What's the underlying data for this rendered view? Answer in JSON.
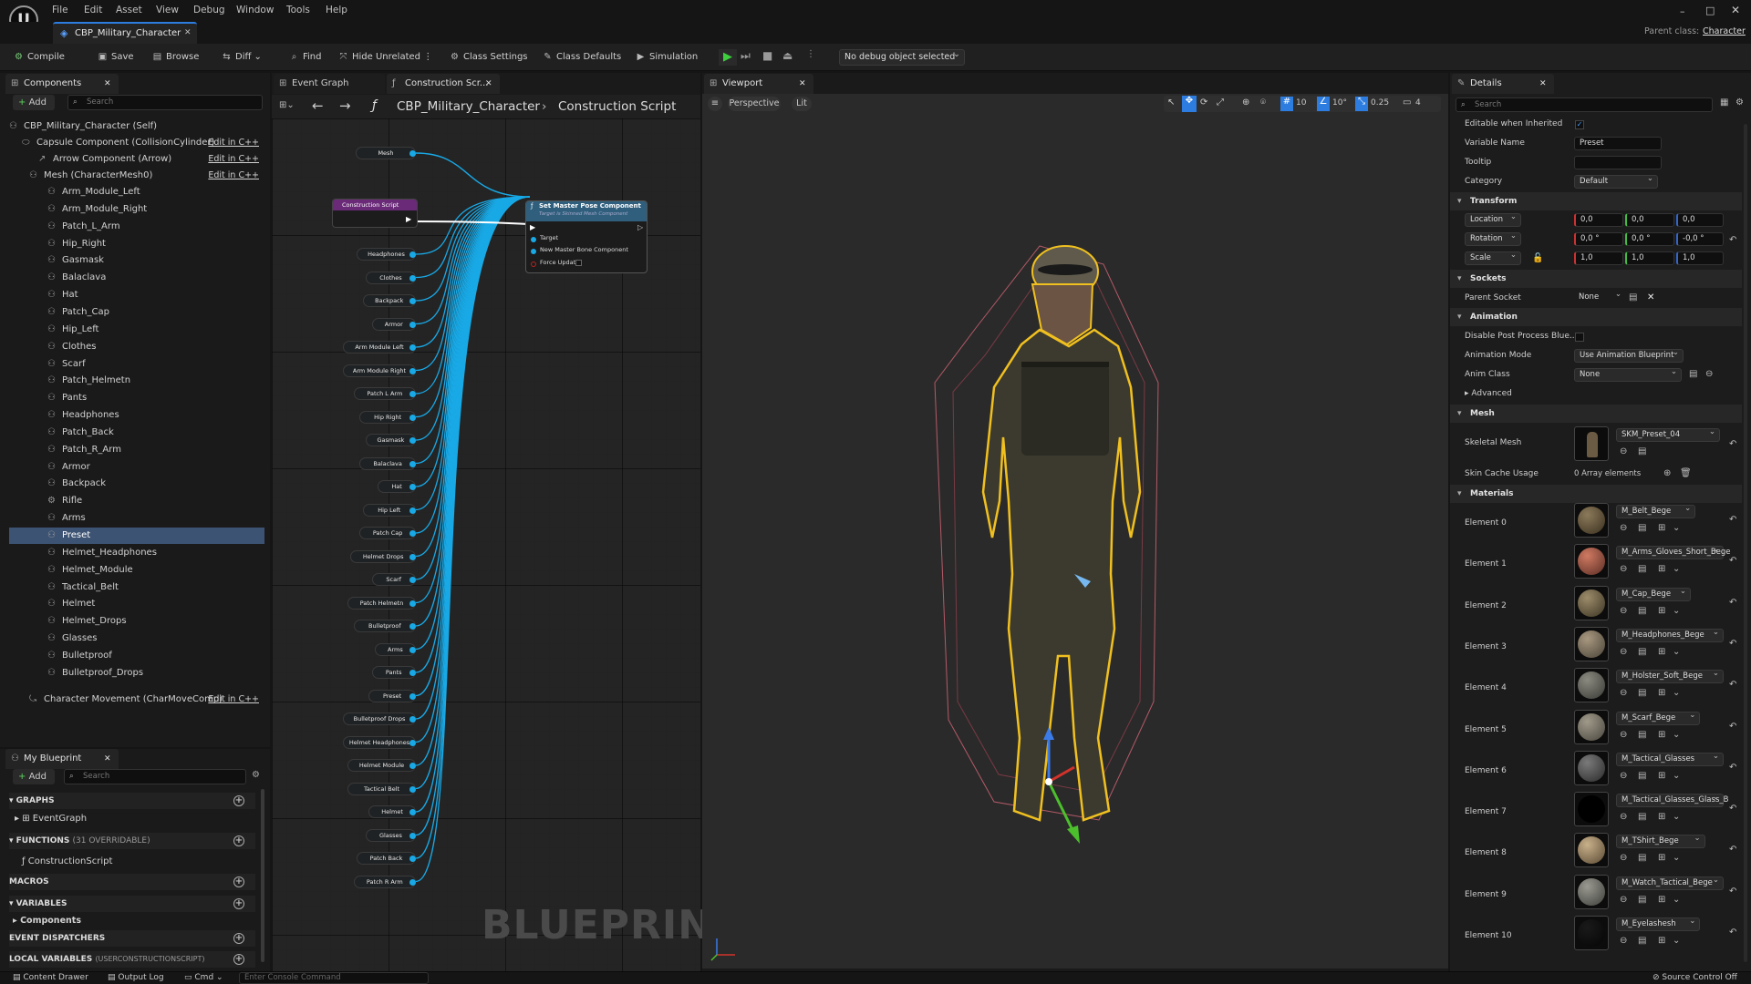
{
  "menu": [
    "File",
    "Edit",
    "Asset",
    "View",
    "Debug",
    "Window",
    "Tools",
    "Help"
  ],
  "document_tab": "CBP_Military_Character",
  "parent_class_label": "Parent class:",
  "parent_class_value": "Character",
  "toolbar": {
    "compile": "Compile",
    "save": "Save",
    "browse": "Browse",
    "diff": "Diff",
    "find": "Find",
    "hide_unrelated": "Hide Unrelated",
    "class_settings": "Class Settings",
    "class_defaults": "Class Defaults",
    "simulation": "Simulation",
    "debug_select": "No debug object selected"
  },
  "components": {
    "tab": "Components",
    "add": "Add",
    "search_placeholder": "Search",
    "root": "CBP_Military_Character (Self)",
    "capsule": "Capsule Component (CollisionCylinder)",
    "arrow": "Arrow Component (Arrow)",
    "mesh": "Mesh (CharacterMesh0)",
    "edit_cpp": "Edit in C++",
    "children": [
      "Arm_Module_Left",
      "Arm_Module_Right",
      "Patch_L_Arm",
      "Hip_Right",
      "Gasmask",
      "Balaclava",
      "Hat",
      "Patch_Cap",
      "Hip_Left",
      "Clothes",
      "Scarf",
      "Patch_Helmetn",
      "Pants",
      "Headphones",
      "Patch_Back",
      "Patch_R_Arm",
      "Armor",
      "Backpack",
      "Rifle",
      "Arms",
      "Preset",
      "Helmet_Headphones",
      "Helmet_Module",
      "Tactical_Belt",
      "Helmet",
      "Helmet_Drops",
      "Glasses",
      "Bulletproof",
      "Bulletproof_Drops"
    ],
    "selected": "Preset",
    "movement": "Character Movement (CharMoveComp)"
  },
  "my_blueprint": {
    "tab": "My Blueprint",
    "add": "Add",
    "search_placeholder": "Search",
    "graphs": "GRAPHS",
    "event_graph": "EventGraph",
    "functions": "FUNCTIONS",
    "functions_note": "(31 OVERRIDABLE)",
    "construction_script": "ConstructionScript",
    "macros": "MACROS",
    "variables": "VARIABLES",
    "components_cat": "Components",
    "event_dispatchers": "EVENT DISPATCHERS",
    "local_variables": "LOCAL VARIABLES",
    "local_variables_note": "(USERCONSTRUCTIONSCRIPT)"
  },
  "graph": {
    "tab_event": "Event Graph",
    "tab_construction": "Construction Scr...",
    "breadcrumb_root": "CBP_Military_Character",
    "breadcrumb_leaf": "Construction Script",
    "watermark": "BLUEPRINT",
    "construction_node": "Construction Script",
    "set_node_title": "Set Master Pose Component",
    "set_node_subtitle": "Target is Skinned Mesh Component",
    "set_node_target": "Target",
    "set_node_master": "New Master Bone Component",
    "set_node_force": "Force Update",
    "mesh_pin": "Mesh",
    "pins": [
      "Headphones",
      "Clothes",
      "Backpack",
      "Armor",
      "Arm Module Left",
      "Arm Module Right",
      "Patch L Arm",
      "Hip Right",
      "Gasmask",
      "Balaclava",
      "Hat",
      "Hip Left",
      "Patch Cap",
      "Helmet Drops",
      "Scarf",
      "Patch Helmetn",
      "Bulletproof",
      "Arms",
      "Pants",
      "Preset",
      "Bulletproof Drops",
      "Helmet Headphones",
      "Helmet Module",
      "Tactical Belt",
      "Helmet",
      "Glasses",
      "Patch Back",
      "Patch R Arm"
    ]
  },
  "viewport": {
    "tab": "Viewport",
    "perspective": "Perspective",
    "lit": "Lit",
    "grid": "10",
    "angle": "10°",
    "scale": "0.25",
    "cam": "4"
  },
  "details": {
    "tab": "Details",
    "search_placeholder": "Search",
    "editable_label": "Editable when Inherited",
    "variable_name_label": "Variable Name",
    "variable_name": "Preset",
    "tooltip_label": "Tooltip",
    "category_label": "Category",
    "category": "Default",
    "transform": "Transform",
    "location": "Location",
    "rotation": "Rotation",
    "scale": "Scale",
    "loc": [
      "0,0",
      "0,0",
      "0,0"
    ],
    "rot": [
      "0,0 °",
      "0,0 °",
      "-0,0 °"
    ],
    "scl": [
      "1,0",
      "1,0",
      "1,0"
    ],
    "sockets": "Sockets",
    "parent_socket_label": "Parent Socket",
    "parent_socket": "None",
    "animation": "Animation",
    "disable_pp": "Disable Post Process Blue...",
    "anim_mode_label": "Animation Mode",
    "anim_mode": "Use Animation Blueprint",
    "anim_class_label": "Anim Class",
    "anim_class": "None",
    "advanced": "Advanced",
    "mesh": "Mesh",
    "skeletal_mesh_label": "Skeletal Mesh",
    "skeletal_mesh": "SKM_Preset_04",
    "skin_cache_label": "Skin Cache Usage",
    "skin_cache": "0 Array elements",
    "materials": "Materials",
    "elements": [
      {
        "label": "Element 0",
        "value": "M_Belt_Bege"
      },
      {
        "label": "Element 1",
        "value": "M_Arms_Gloves_Short_Bege"
      },
      {
        "label": "Element 2",
        "value": "M_Cap_Bege"
      },
      {
        "label": "Element 3",
        "value": "M_Headphones_Bege"
      },
      {
        "label": "Element 4",
        "value": "M_Holster_Soft_Bege"
      },
      {
        "label": "Element 5",
        "value": "M_Scarf_Bege"
      },
      {
        "label": "Element 6",
        "value": "M_Tactical_Glasses"
      },
      {
        "label": "Element 7",
        "value": "M_Tactical_Glasses_Glass_B"
      },
      {
        "label": "Element 8",
        "value": "M_TShirt_Bege"
      },
      {
        "label": "Element 9",
        "value": "M_Watch_Tactical_Bege"
      },
      {
        "label": "Element 10",
        "value": "M_Eyelashesh"
      }
    ]
  },
  "statusbar": {
    "content_drawer": "Content Drawer",
    "output_log": "Output Log",
    "cmd": "Cmd",
    "console_placeholder": "Enter Console Command",
    "source_control": "Source Control Off"
  },
  "colors": {
    "accent": "#2d7de0",
    "wire": "#18a9e6",
    "selection": "#3d5373",
    "outline": "#f0c020"
  }
}
